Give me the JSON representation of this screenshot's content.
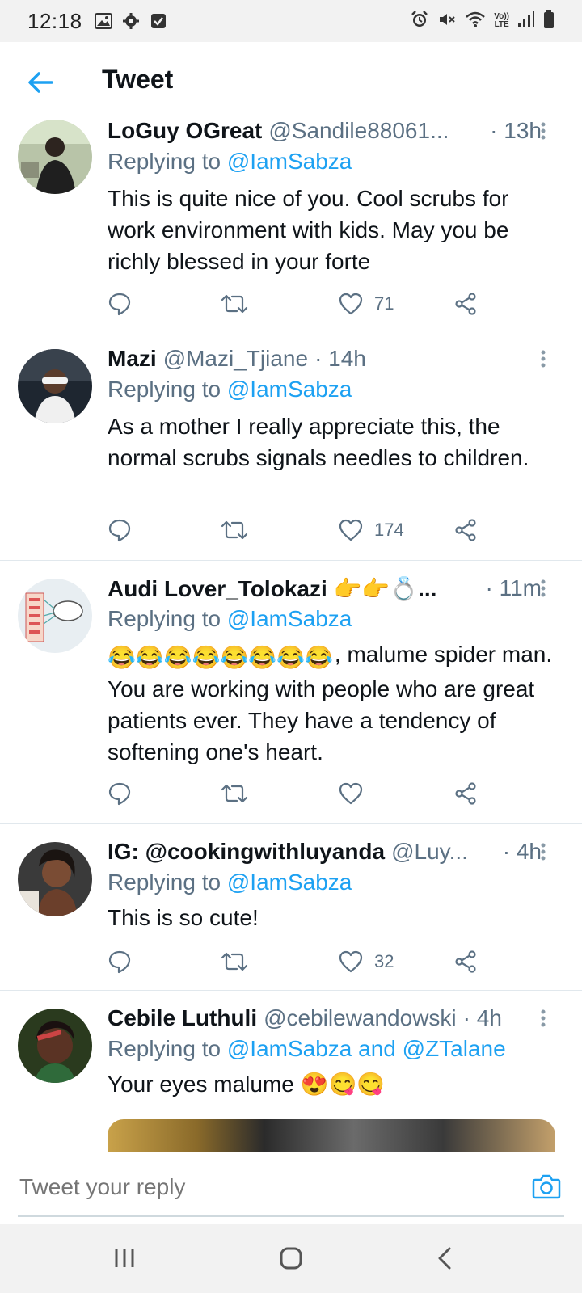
{
  "status_bar": {
    "time": "12:18",
    "left_icons": [
      "image-icon",
      "gear-icon",
      "checkbox-icon"
    ],
    "right_icons": [
      "alarm-icon",
      "mute-icon",
      "wifi-icon",
      "volte-icon",
      "signal-icon",
      "battery-icon"
    ],
    "volte_top": "Vo))",
    "volte_bottom": "LTE"
  },
  "header": {
    "title": "Tweet"
  },
  "colors": {
    "accent": "#1da1f2",
    "muted": "#5b7083",
    "text": "#0f1419",
    "divider": "#e1e8ed"
  },
  "tweets": [
    {
      "name": "LoGuy OGreat",
      "handle": "@Sandile88061...",
      "time": "· 13h",
      "replying_prefix": "Replying to ",
      "replying_to": "@IamSabza",
      "text": "This is quite nice of you. Cool scrubs for work environment with kids. May you be richly blessed in your forte",
      "likes": "71"
    },
    {
      "name": "Mazi",
      "handle": "@Mazi_Tjiane",
      "time": "· 14h",
      "replying_prefix": "Replying to ",
      "replying_to": "@IamSabza",
      "text": "As a mother I really appreciate this, the normal scrubs signals needles to children.",
      "likes": "174"
    },
    {
      "name": "Audi Lover_Tolokazi 👉👉💍...",
      "handle": "",
      "time": "· 11m",
      "replying_prefix": "Replying to ",
      "replying_to": "@IamSabza",
      "text_emojis": "😂😂😂😂😂😂😂😂",
      "text": ", malume spider man. You are working with people who are great patients ever. They have a tendency of softening one's heart.",
      "likes": ""
    },
    {
      "name": "IG: @cookingwithluyanda",
      "handle": "@Luy...",
      "time": "· 4h",
      "replying_prefix": "Replying to ",
      "replying_to": "@IamSabza",
      "text": "This is so cute!",
      "likes": "32"
    },
    {
      "name": "Cebile Luthuli",
      "handle": "@cebilewandowski",
      "time": "· 4h",
      "replying_prefix": "Replying to ",
      "replying_to": "@IamSabza and @ZTalane",
      "text": "Your eyes malume 😍😋😋",
      "likes": ""
    }
  ],
  "reply_bar": {
    "placeholder": "Tweet your reply"
  },
  "nav_bar": {
    "buttons": [
      "recents-button",
      "home-button",
      "back-button"
    ]
  }
}
